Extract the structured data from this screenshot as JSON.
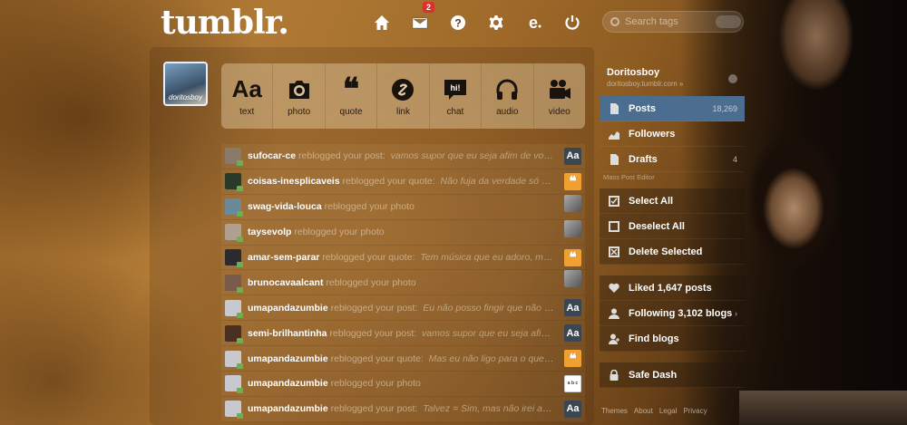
{
  "brand": {
    "logo": "tumblr."
  },
  "nav": {
    "inbox_badge": "2"
  },
  "search": {
    "placeholder": "Search tags"
  },
  "avatar": {
    "label": "doritosboy"
  },
  "post_types": [
    {
      "label": "text",
      "icon": "text-icon",
      "glyph": "Aa"
    },
    {
      "label": "photo",
      "icon": "camera-icon"
    },
    {
      "label": "quote",
      "icon": "quote-icon",
      "glyph": "❝"
    },
    {
      "label": "link",
      "icon": "link-icon"
    },
    {
      "label": "chat",
      "icon": "chat-icon",
      "glyph": "hi!"
    },
    {
      "label": "audio",
      "icon": "headphones-icon"
    },
    {
      "label": "video",
      "icon": "video-camera-icon"
    }
  ],
  "activity": [
    {
      "user": "sufocar-ce",
      "action": "reblogged your post:",
      "excerpt": "vamos supor que eu seja afim de você...",
      "type": "text",
      "type_glyph": "Aa",
      "avatar_color": "#8a7a6a"
    },
    {
      "user": "coisas-inesplicaveis",
      "action": "reblogged your quote:",
      "excerpt": "Não fuja da verdade só porque...",
      "type": "quote",
      "type_glyph": "❝",
      "avatar_color": "#2a3a2a"
    },
    {
      "user": "swag-vida-louca",
      "action": "reblogged your photo",
      "excerpt": "",
      "type": "photo",
      "type_glyph": "",
      "avatar_color": "#6a8a9a"
    },
    {
      "user": "taysevolp",
      "action": "reblogged your photo",
      "excerpt": "",
      "type": "photo",
      "type_glyph": "",
      "avatar_color": "#b0a090"
    },
    {
      "user": "amar-sem-parar",
      "action": "reblogged your quote:",
      "excerpt": "Tem música que eu adoro, mas ac...",
      "type": "quote",
      "type_glyph": "❝",
      "avatar_color": "#2a2a30"
    },
    {
      "user": "brunocavaalcant",
      "action": "reblogged your photo",
      "excerpt": "",
      "type": "photo",
      "type_glyph": "",
      "avatar_color": "#7a5a4a"
    },
    {
      "user": "umapandazumbie",
      "action": "reblogged your post:",
      "excerpt": "Eu não posso fingir que não sinto...",
      "type": "text",
      "type_glyph": "Aa",
      "avatar_color": "#c8c8d0"
    },
    {
      "user": "semi-brilhantinha",
      "action": "reblogged your post:",
      "excerpt": "vamos supor que eu seja afim de v...",
      "type": "text",
      "type_glyph": "Aa",
      "avatar_color": "#4a3020"
    },
    {
      "user": "umapandazumbie",
      "action": "reblogged your quote:",
      "excerpt": "Mas eu não ligo para o que você...",
      "type": "quote",
      "type_glyph": "❝",
      "avatar_color": "#c8c8d0"
    },
    {
      "user": "umapandazumbie",
      "action": "reblogged your photo",
      "excerpt": "",
      "type": "photo2",
      "type_glyph": "a b c",
      "avatar_color": "#c8c8d0"
    },
    {
      "user": "umapandazumbie",
      "action": "reblogged your post:",
      "excerpt": "Talvez = Sim, mas não irei admitir...",
      "type": "text",
      "type_glyph": "Aa",
      "avatar_color": "#c8c8d0"
    }
  ],
  "sidebar": {
    "blog_name": "Doritosboy",
    "blog_url": "doritosboy.tumblr.com »",
    "posts_label": "Posts",
    "posts_count": "18,269",
    "followers_label": "Followers",
    "drafts_label": "Drafts",
    "drafts_count": "4",
    "mass_post_editor": "Mass Post Editor",
    "select_all": "Select All",
    "deselect_all": "Deselect All",
    "delete_selected": "Delete Selected",
    "liked": "Liked 1,647 posts",
    "following": "Following 3,102 blogs",
    "find_blogs": "Find blogs",
    "safe_dash": "Safe Dash",
    "arrow": "›"
  },
  "footer": {
    "themes": "Themes",
    "about": "About",
    "legal": "Legal",
    "privacy": "Privacy"
  }
}
